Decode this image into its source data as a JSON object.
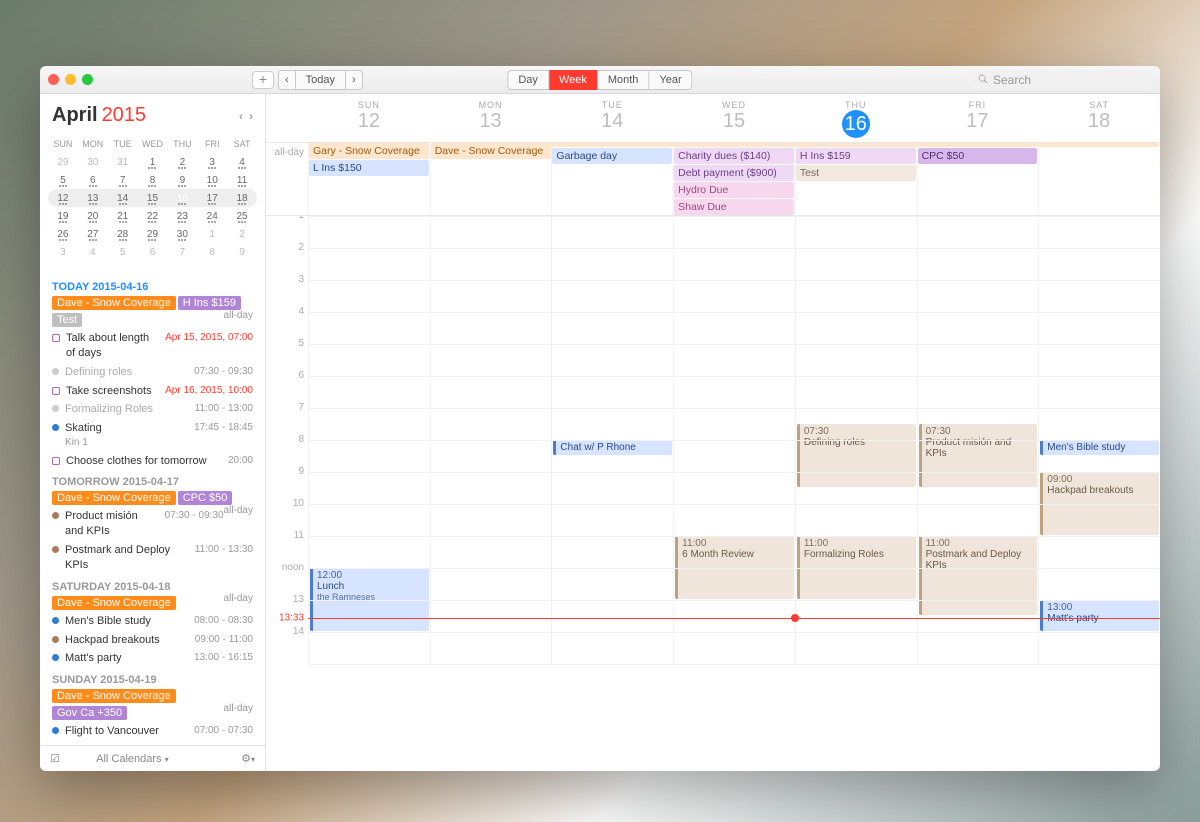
{
  "toolbar": {
    "today_label": "Today",
    "views": [
      "Day",
      "Week",
      "Month",
      "Year"
    ],
    "active_view": "Week",
    "search_placeholder": "Search"
  },
  "sidebar": {
    "month": "April",
    "year": "2015",
    "dows": [
      "SUN",
      "MON",
      "TUE",
      "WED",
      "THU",
      "FRI",
      "SAT"
    ],
    "mini": [
      [
        {
          "n": "29",
          "dim": true
        },
        {
          "n": "30",
          "dim": true
        },
        {
          "n": "31",
          "dim": true
        },
        {
          "n": "1"
        },
        {
          "n": "2"
        },
        {
          "n": "3"
        },
        {
          "n": "4"
        }
      ],
      [
        {
          "n": "5"
        },
        {
          "n": "6"
        },
        {
          "n": "7"
        },
        {
          "n": "8"
        },
        {
          "n": "9"
        },
        {
          "n": "10"
        },
        {
          "n": "11"
        }
      ],
      [
        {
          "n": "12"
        },
        {
          "n": "13"
        },
        {
          "n": "14"
        },
        {
          "n": "15"
        },
        {
          "n": "16",
          "today": true
        },
        {
          "n": "17"
        },
        {
          "n": "18"
        }
      ],
      [
        {
          "n": "19"
        },
        {
          "n": "20"
        },
        {
          "n": "21"
        },
        {
          "n": "22"
        },
        {
          "n": "23"
        },
        {
          "n": "24"
        },
        {
          "n": "25"
        }
      ],
      [
        {
          "n": "26"
        },
        {
          "n": "27"
        },
        {
          "n": "28"
        },
        {
          "n": "29"
        },
        {
          "n": "30"
        },
        {
          "n": "1",
          "dim": true
        },
        {
          "n": "2",
          "dim": true
        }
      ],
      [
        {
          "n": "3",
          "dim": true
        },
        {
          "n": "4",
          "dim": true
        },
        {
          "n": "5",
          "dim": true
        },
        {
          "n": "6",
          "dim": true
        },
        {
          "n": "7",
          "dim": true
        },
        {
          "n": "8",
          "dim": true
        },
        {
          "n": "9",
          "dim": true
        }
      ]
    ],
    "agenda": [
      {
        "header": "TODAY 2015-04-16",
        "today": true,
        "allday": "all-day",
        "chips": [
          {
            "text": "Dave - Snow Coverage",
            "cls": "orange"
          },
          {
            "text": "H Ins $159",
            "cls": "purple"
          },
          {
            "text": "Test",
            "cls": "grey"
          }
        ],
        "items": [
          {
            "kind": "box",
            "label": "Talk about length of days",
            "time": "Apr 15, 2015, 07:00",
            "red": true
          },
          {
            "kind": "dot",
            "color": "#ccc",
            "label": "Defining roles",
            "dim": true,
            "time": "07:30 - 09:30"
          },
          {
            "kind": "box",
            "label": "Take screenshots",
            "time": "Apr 16, 2015, 10:00",
            "red": true
          },
          {
            "kind": "dot",
            "color": "#ccc",
            "label": "Formalizing Roles",
            "dim": true,
            "time": "11:00 - 13:00"
          },
          {
            "kind": "dot",
            "color": "#2d7bd8",
            "label": "Skating",
            "sub": "Kin 1",
            "time": "17:45 - 18:45"
          },
          {
            "kind": "box",
            "label": "Choose clothes for tomorrow",
            "time": "20:00"
          }
        ]
      },
      {
        "header": "TOMORROW 2015-04-17",
        "allday": "all-day",
        "chips": [
          {
            "text": "Dave - Snow Coverage",
            "cls": "orange"
          },
          {
            "text": "CPC $50",
            "cls": "purple"
          }
        ],
        "items": [
          {
            "kind": "dot",
            "color": "#a87c5a",
            "label": "Product misión and KPIs",
            "time": "07:30 - 09:30"
          },
          {
            "kind": "dot",
            "color": "#a87c5a",
            "label": "Postmark and Deploy KPIs",
            "time": "11:00 - 13:30"
          }
        ]
      },
      {
        "header": "SATURDAY 2015-04-18",
        "allday": "all-day",
        "chips": [
          {
            "text": "Dave - Snow Coverage",
            "cls": "orange"
          }
        ],
        "items": [
          {
            "kind": "dot",
            "color": "#2d7bd8",
            "label": "Men's Bible study",
            "time": "08:00 - 08:30"
          },
          {
            "kind": "dot",
            "color": "#a87c5a",
            "label": "Hackpad breakouts",
            "time": "09:00 - 11:00"
          },
          {
            "kind": "dot",
            "color": "#2d7bd8",
            "label": "Matt's party",
            "time": "13:00 - 16:15"
          }
        ]
      },
      {
        "header": "SUNDAY 2015-04-19",
        "allday": "all-day",
        "chips": [
          {
            "text": "Dave - Snow Coverage",
            "cls": "orange"
          },
          {
            "text": "Gov Ca +350",
            "cls": "purple"
          }
        ],
        "items": [
          {
            "kind": "dot",
            "color": "#2d7bd8",
            "label": "Flight to Vancouver",
            "time": "07:00 - 07:30"
          }
        ]
      }
    ],
    "footer_label": "All Calendars"
  },
  "week": {
    "days": [
      {
        "dow": "SUN",
        "num": "12"
      },
      {
        "dow": "MON",
        "num": "13"
      },
      {
        "dow": "TUE",
        "num": "14"
      },
      {
        "dow": "WED",
        "num": "15"
      },
      {
        "dow": "THU",
        "num": "16",
        "today": true
      },
      {
        "dow": "FRI",
        "num": "17"
      },
      {
        "dow": "SAT",
        "num": "18"
      }
    ],
    "allday_label": "all-day",
    "allday": [
      [
        {
          "text": "Gary - Snow Coverage",
          "cls": "c-orange-l"
        },
        {
          "text": "L Ins $150",
          "cls": "c-blue-l"
        }
      ],
      [
        {
          "text": "Dave - Snow Coverage",
          "cls": "c-orange-l",
          "span": 6
        }
      ],
      [
        {
          "text": "Garbage day",
          "cls": "c-blue-l"
        }
      ],
      [
        {
          "text": "Charity dues ($140)",
          "cls": "c-purple-l"
        },
        {
          "text": "Debt payment ($900)",
          "cls": "c-purple-l"
        },
        {
          "text": "Hydro Due",
          "cls": "c-pink"
        },
        {
          "text": "Shaw Due",
          "cls": "c-pink"
        }
      ],
      [
        {
          "text": "H Ins $159",
          "cls": "c-purple-l"
        },
        {
          "text": "Test",
          "cls": "c-cream"
        }
      ],
      [
        {
          "text": "CPC $50",
          "cls": "c-purple-m"
        }
      ],
      []
    ],
    "hours": [
      "1",
      "2",
      "3",
      "4",
      "5",
      "6",
      "7",
      "8",
      "9",
      "10",
      "11",
      "noon",
      "13",
      "14"
    ],
    "now": "13:33",
    "events": [
      {
        "day": 0,
        "start": 12,
        "end": 14,
        "cls": "e-blue",
        "time": "12:00",
        "name": "Lunch",
        "sub": "the Ramneses"
      },
      {
        "day": 2,
        "start": 8,
        "end": 8.5,
        "cls": "e-blue",
        "time": "",
        "name": "Chat w/ P Rhone"
      },
      {
        "day": 3,
        "start": 11,
        "end": 13,
        "cls": "e-beige",
        "time": "11:00",
        "name": "6 Month Review"
      },
      {
        "day": 4,
        "start": 7.5,
        "end": 9.5,
        "cls": "e-beige",
        "time": "07:30",
        "name": "Defining roles"
      },
      {
        "day": 4,
        "start": 11,
        "end": 13,
        "cls": "e-beige",
        "time": "11:00",
        "name": "Formalizing Roles"
      },
      {
        "day": 5,
        "start": 7.5,
        "end": 9.5,
        "cls": "e-beige",
        "time": "07:30",
        "name": "Product misión and KPIs"
      },
      {
        "day": 5,
        "start": 11,
        "end": 13.5,
        "cls": "e-beige",
        "time": "11:00",
        "name": "Postmark and Deploy KPIs"
      },
      {
        "day": 6,
        "start": 8,
        "end": 8.5,
        "cls": "e-blue",
        "time": "",
        "name": "Men's Bible study"
      },
      {
        "day": 6,
        "start": 9,
        "end": 11,
        "cls": "e-beige",
        "time": "09:00",
        "name": "Hackpad breakouts"
      },
      {
        "day": 6,
        "start": 13,
        "end": 14,
        "cls": "e-blue",
        "time": "13:00",
        "name": "Matt's party"
      }
    ]
  }
}
